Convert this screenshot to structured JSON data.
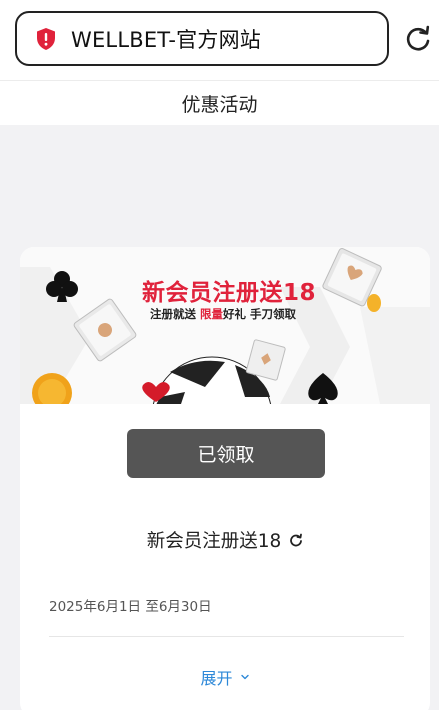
{
  "browser": {
    "url_text": "WELLBET-官方网站"
  },
  "page": {
    "title": "优惠活动"
  },
  "promo": {
    "banner_title_main": "新会员注册送18",
    "banner_sub_a": "注册就送",
    "banner_sub_highlight": "限量",
    "banner_sub_b": "好礼 手刀领取",
    "claim_button": "已领取",
    "name": "新会员注册送18",
    "date_range": "2025年6月1日 至6月30日",
    "expand_label": "展开"
  },
  "colors": {
    "accent_red": "#e0223b",
    "link_blue": "#2d88d8",
    "button_gray": "#555555"
  }
}
